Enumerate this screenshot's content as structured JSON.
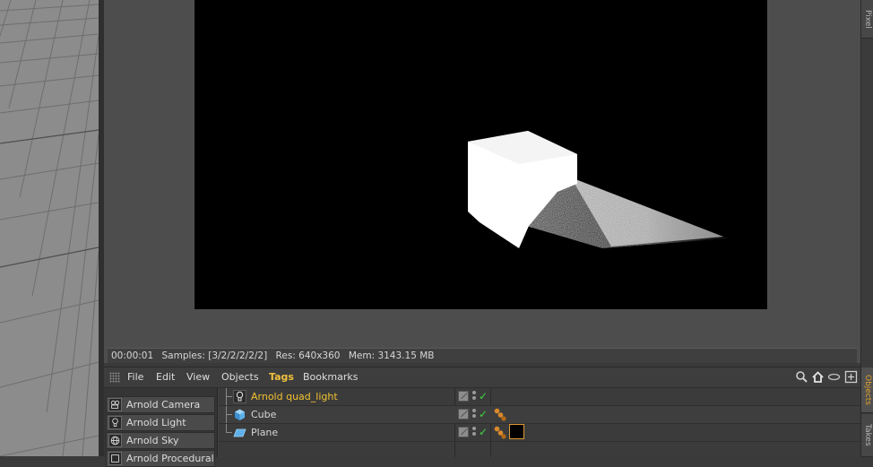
{
  "status_bar": {
    "time": "00:00:01",
    "samples": "Samples: [3/2/2/2/2/2]",
    "resolution": "Res: 640x360",
    "memory": "Mem: 3143.15 MB"
  },
  "side_tabs": {
    "pixel": "Pixel",
    "objects": "Objects",
    "takes": "Takes"
  },
  "menu": {
    "items": [
      "File",
      "Edit",
      "View",
      "Objects",
      "Tags",
      "Bookmarks"
    ],
    "active": "Tags"
  },
  "palette": {
    "items": [
      {
        "label": "Arnold Camera",
        "icon": "camera-icon"
      },
      {
        "label": "Arnold Light",
        "icon": "lightbulb-icon"
      },
      {
        "label": "Arnold Sky",
        "icon": "globe-icon"
      },
      {
        "label": "Arnold Procedural",
        "icon": "procedural-icon"
      }
    ]
  },
  "objects": [
    {
      "name": "Arnold quad_light",
      "icon": "lightbulb-icon",
      "selected": true,
      "tags": []
    },
    {
      "name": "Cube",
      "icon": "cube-icon",
      "selected": false,
      "tags": [
        "phong-tag-icon"
      ]
    },
    {
      "name": "Plane",
      "icon": "plane-icon",
      "selected": false,
      "tags": [
        "phong-tag-icon",
        "material-tag"
      ]
    }
  ],
  "colors": {
    "accent": "#f2c231",
    "check": "#3fd43f",
    "render_background": "#000000"
  }
}
